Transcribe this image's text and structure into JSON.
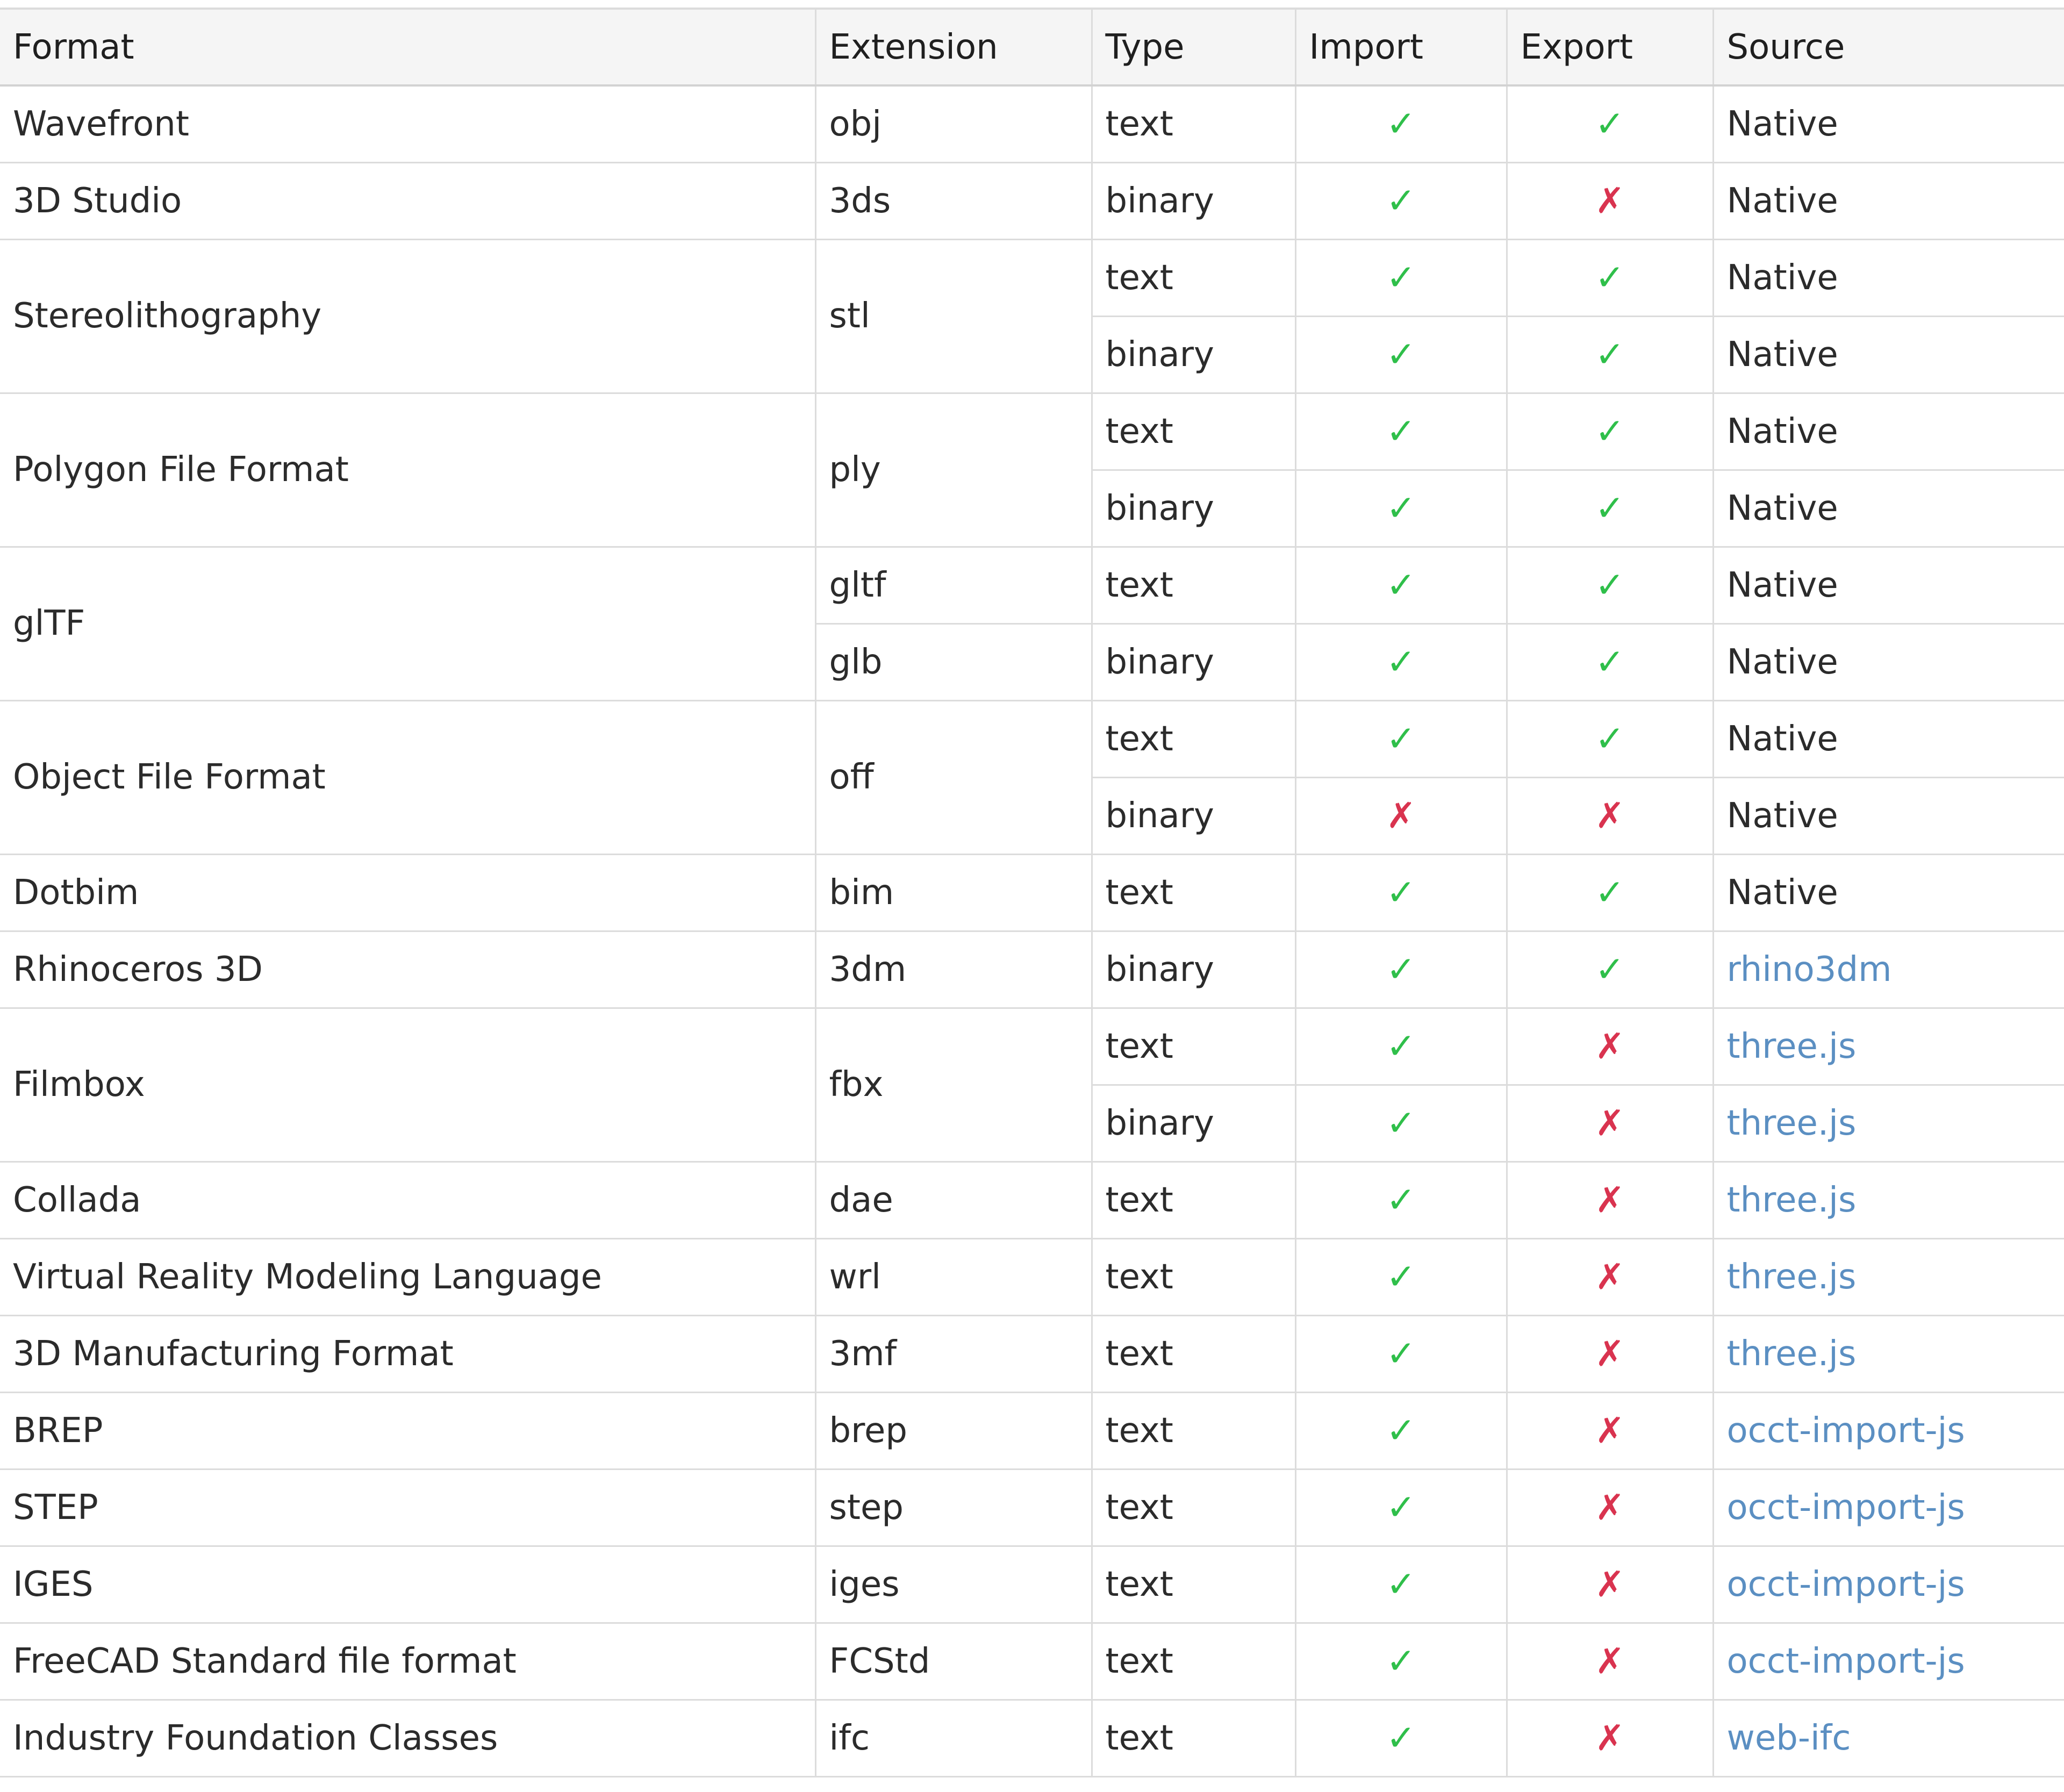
{
  "headers": {
    "format": "Format",
    "extension": "Extension",
    "type": "Type",
    "import": "Import",
    "export": "Export",
    "source": "Source"
  },
  "marks": {
    "yes": "✓",
    "no": "✗"
  },
  "colors": {
    "yes": "#2fbf4a",
    "no": "#d9334f",
    "link": "#5b8fc2",
    "border": "#dcdcdc",
    "header_bg": "#f5f5f5"
  },
  "formats": [
    {
      "name": "Wavefront",
      "extensions": [
        "obj"
      ],
      "variants": [
        {
          "type": "text",
          "import": true,
          "export": true,
          "source": "Native"
        }
      ]
    },
    {
      "name": "3D Studio",
      "extensions": [
        "3ds"
      ],
      "variants": [
        {
          "type": "binary",
          "import": true,
          "export": false,
          "source": "Native"
        }
      ]
    },
    {
      "name": "Stereolithography",
      "extensions": [
        "stl"
      ],
      "variants": [
        {
          "type": "text",
          "import": true,
          "export": true,
          "source": "Native"
        },
        {
          "type": "binary",
          "import": true,
          "export": true,
          "source": "Native"
        }
      ]
    },
    {
      "name": "Polygon File Format",
      "extensions": [
        "ply"
      ],
      "variants": [
        {
          "type": "text",
          "import": true,
          "export": true,
          "source": "Native"
        },
        {
          "type": "binary",
          "import": true,
          "export": true,
          "source": "Native"
        }
      ]
    },
    {
      "name": "glTF",
      "extensions": [
        "gltf",
        "glb"
      ],
      "variants": [
        {
          "type": "text",
          "import": true,
          "export": true,
          "source": "Native"
        },
        {
          "type": "binary",
          "import": true,
          "export": true,
          "source": "Native"
        }
      ]
    },
    {
      "name": "Object File Format",
      "extensions": [
        "off"
      ],
      "variants": [
        {
          "type": "text",
          "import": true,
          "export": true,
          "source": "Native"
        },
        {
          "type": "binary",
          "import": false,
          "export": false,
          "source": "Native"
        }
      ]
    },
    {
      "name": "Dotbim",
      "extensions": [
        "bim"
      ],
      "variants": [
        {
          "type": "text",
          "import": true,
          "export": true,
          "source": "Native"
        }
      ]
    },
    {
      "name": "Rhinoceros 3D",
      "extensions": [
        "3dm"
      ],
      "variants": [
        {
          "type": "binary",
          "import": true,
          "export": true,
          "source": "rhino3dm"
        }
      ]
    },
    {
      "name": "Filmbox",
      "extensions": [
        "fbx"
      ],
      "variants": [
        {
          "type": "text",
          "import": true,
          "export": false,
          "source": "three.js"
        },
        {
          "type": "binary",
          "import": true,
          "export": false,
          "source": "three.js"
        }
      ]
    },
    {
      "name": "Collada",
      "extensions": [
        "dae"
      ],
      "variants": [
        {
          "type": "text",
          "import": true,
          "export": false,
          "source": "three.js"
        }
      ]
    },
    {
      "name": "Virtual Reality Modeling Language",
      "extensions": [
        "wrl"
      ],
      "variants": [
        {
          "type": "text",
          "import": true,
          "export": false,
          "source": "three.js"
        }
      ]
    },
    {
      "name": "3D Manufacturing Format",
      "extensions": [
        "3mf"
      ],
      "variants": [
        {
          "type": "text",
          "import": true,
          "export": false,
          "source": "three.js"
        }
      ]
    },
    {
      "name": "BREP",
      "extensions": [
        "brep"
      ],
      "variants": [
        {
          "type": "text",
          "import": true,
          "export": false,
          "source": "occt-import-js"
        }
      ]
    },
    {
      "name": "STEP",
      "extensions": [
        "step"
      ],
      "variants": [
        {
          "type": "text",
          "import": true,
          "export": false,
          "source": "occt-import-js"
        }
      ]
    },
    {
      "name": "IGES",
      "extensions": [
        "iges"
      ],
      "variants": [
        {
          "type": "text",
          "import": true,
          "export": false,
          "source": "occt-import-js"
        }
      ]
    },
    {
      "name": "FreeCAD Standard file format",
      "extensions": [
        "FCStd"
      ],
      "variants": [
        {
          "type": "text",
          "import": true,
          "export": false,
          "source": "occt-import-js"
        }
      ]
    },
    {
      "name": "Industry Foundation Classes",
      "extensions": [
        "ifc"
      ],
      "variants": [
        {
          "type": "text",
          "import": true,
          "export": false,
          "source": "web-ifc"
        }
      ]
    }
  ]
}
